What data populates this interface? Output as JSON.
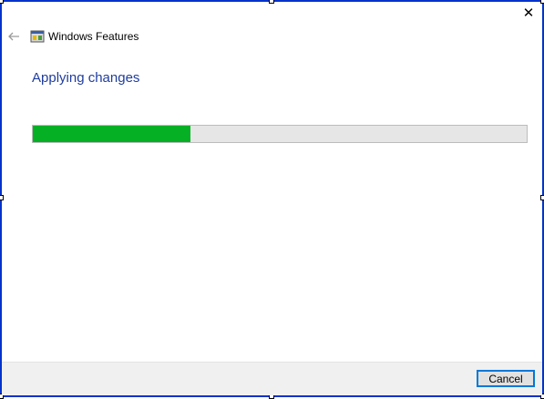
{
  "window": {
    "title": "Windows Features",
    "close_glyph": "✕",
    "back_icon": "back-arrow-icon",
    "app_icon": "windows-features-icon"
  },
  "main": {
    "heading": "Applying changes",
    "progress_percent": 32,
    "progress_color": "#06b025"
  },
  "footer": {
    "cancel_label": "Cancel"
  },
  "colors": {
    "border": "#0033cc",
    "heading": "#1f3d9e",
    "button_focus": "#0078d7"
  }
}
